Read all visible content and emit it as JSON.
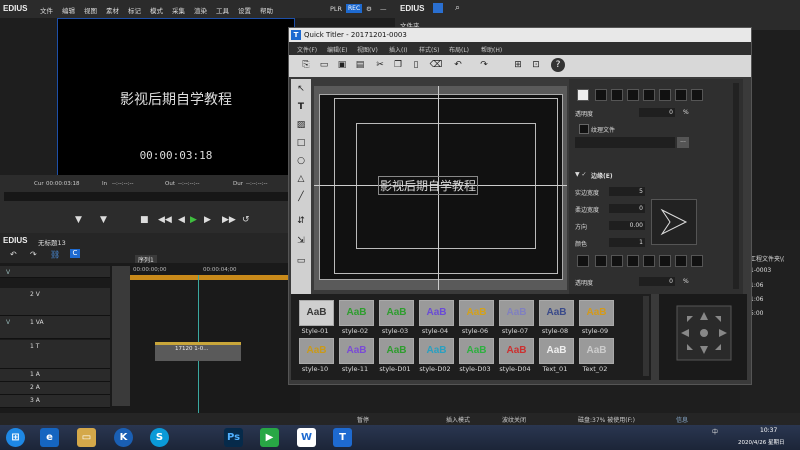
{
  "app": {
    "logo": "EDIUS",
    "menu": [
      "文件",
      "编辑",
      "视图",
      "素材",
      "标记",
      "模式",
      "采集",
      "渲染",
      "工具",
      "设置",
      "帮助"
    ],
    "plr": "PLR",
    "rec": "REC"
  },
  "right_app": {
    "logo": "EDIUS",
    "label": "文件夹"
  },
  "monitor": {
    "title_text": "影视后期自学教程",
    "timecode": "00:00:03:18"
  },
  "transport": {
    "cur_label": "Cur",
    "cur_value": "00:00:03:18",
    "in_label": "In",
    "in_value": "--:--:--:--",
    "out_label": "Out",
    "out_value": "--:--:--:--",
    "dur_label": "Dur",
    "dur_value": "--:--:--:--"
  },
  "timeline": {
    "logo": "EDIUS",
    "project": "无标题13",
    "tab": "序列1",
    "ruler_start": "00:00:00;00",
    "ruler_mark": "00:00:04;00",
    "tracks": [
      {
        "type": "V",
        "name": ""
      },
      {
        "type": "",
        "name": "2 V"
      },
      {
        "type": "V",
        "name": "1 VA"
      },
      {
        "type": "",
        "name": "1 T"
      },
      {
        "type": "",
        "name": "1 A"
      },
      {
        "type": "",
        "name": "2 A"
      },
      {
        "type": "",
        "name": "3 A"
      }
    ],
    "clip_label": "17120 1-0..."
  },
  "status": {
    "pause": "暂停",
    "insert": "插入模式",
    "ripple": "波纹关闭",
    "disk": "磁盘:37% 被使用(F:)",
    "info": "信息"
  },
  "bin": {
    "items": [
      "工程文件夹\\(",
      "1-0003",
      "1:06",
      "1:06",
      "5:00"
    ]
  },
  "quick_titler": {
    "title": "Quick Titler - 20171201-0003",
    "menu": [
      "文件(F)",
      "编辑(E)",
      "视图(V)",
      "插入(I)",
      "样式(S)",
      "布局(L)",
      "帮助(H)"
    ],
    "canvas_text": "影视后期自学教程",
    "props": {
      "transparency_label": "透明度",
      "transparency_value": "0",
      "pct": "%",
      "texture_label": "纹理文件",
      "texture_btn": "...",
      "edge_label": "边缘(E)",
      "solid_label": "实边宽度",
      "solid_value": "5",
      "soft_label": "柔边宽度",
      "soft_value": "0",
      "dir_label": "方向",
      "dir_value": "0.00",
      "color_label": "颜色",
      "color_value": "1",
      "transparency2_label": "透明度",
      "transparency2_value": "0"
    },
    "styles": [
      {
        "label": "Style-01",
        "text": "AaB"
      },
      {
        "label": "style-02",
        "text": "AaB"
      },
      {
        "label": "style-03",
        "text": "AaB"
      },
      {
        "label": "style-04",
        "text": "AaB"
      },
      {
        "label": "style-06",
        "text": "AaB"
      },
      {
        "label": "style-07",
        "text": "AaB"
      },
      {
        "label": "style-08",
        "text": "AaB"
      },
      {
        "label": "style-09",
        "text": "AaB"
      },
      {
        "label": "style-10",
        "text": "AaB"
      },
      {
        "label": "style-11",
        "text": "AaB"
      },
      {
        "label": "style-D01",
        "text": "AaB"
      },
      {
        "label": "style-D02",
        "text": "AaB"
      },
      {
        "label": "style-D03",
        "text": "AaB"
      },
      {
        "label": "style-D04",
        "text": "AaB"
      },
      {
        "label": "Text_01",
        "text": "AaB"
      },
      {
        "label": "Text_02",
        "text": "AaB"
      }
    ]
  },
  "taskbar": {
    "time": "10:37",
    "date": "2020/4/26 星期日",
    "ime": "中"
  },
  "colors": {
    "accent": "#1e6ad0",
    "play": "#3fbf3f",
    "clip": "#c9a63a"
  }
}
